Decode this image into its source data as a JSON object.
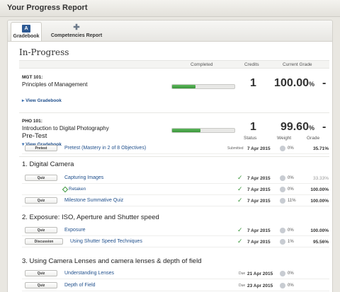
{
  "header": {
    "title": "Your Progress Report"
  },
  "tabs": [
    {
      "label": "Gradebook",
      "icon": "gradebook-icon",
      "active": true
    },
    {
      "label": "Competencies Report",
      "icon": "puzzle-icon",
      "active": false
    }
  ],
  "section_title": "In-Progress",
  "columns": {
    "completed": "Completed",
    "credits": "Credits",
    "current_grade": "Current Grade"
  },
  "courses": [
    {
      "code": "MGT 101:",
      "name": "Principles of Management",
      "progress": 0.37,
      "credits": "1",
      "grade": "100.00",
      "grade_suffix": "%",
      "dash": "-",
      "link": "View Gradebook",
      "expanded": false
    },
    {
      "code": "PHO 101:",
      "name": "Introduction to Digital Photography",
      "progress": 0.45,
      "credits": "1",
      "grade": "99.60",
      "grade_suffix": "%",
      "dash": "-",
      "link": "View Gradebook",
      "expanded": true
    }
  ],
  "item_columns": {
    "status": "Status",
    "weight": "Weight",
    "grade": "Grade"
  },
  "units": [
    {
      "title": "Pre-Test",
      "items": [
        {
          "type": "Pretest",
          "name": "Pretest (Mastery in 2 of 8 Objectives)",
          "status": "Submitted",
          "date": "7 Apr 2015",
          "weight": "0%",
          "grade": "35.71%"
        }
      ]
    },
    {
      "title": "1. Digital Camera",
      "items": [
        {
          "type": "Quiz",
          "name": "Capturing Images",
          "check": true,
          "date": "7 Apr 2015",
          "weight": "0%",
          "grade": "33.33%",
          "muted": true
        },
        {
          "type": "",
          "name": "Retaken",
          "check": true,
          "date": "7 Apr 2015",
          "weight": "0%",
          "grade": "100.00%",
          "retaken": true
        },
        {
          "type": "Quiz",
          "name": "Milestone Summative Quiz",
          "check": true,
          "date": "7 Apr 2015",
          "weight": "11%",
          "grade": "100.00%"
        }
      ]
    },
    {
      "title": "2. Exposure: ISO, Aperture and Shutter speed",
      "items": [
        {
          "type": "Quiz",
          "name": "Exposure",
          "check": true,
          "date": "7 Apr 2015",
          "weight": "0%",
          "grade": "100.00%"
        },
        {
          "type": "Discussion",
          "name": "Using Shutter Speed Techniques",
          "check": true,
          "date": "7 Apr 2015",
          "weight": "1%",
          "grade": "95.56%"
        }
      ]
    },
    {
      "title": "3. Using Camera Lenses and camera lenses & depth of field",
      "items": [
        {
          "type": "Quiz",
          "name": "Understanding Lenses",
          "status": "Due",
          "date": "21 Apr 2015",
          "weight": "0%",
          "grade": ""
        },
        {
          "type": "Quiz",
          "name": "Depth of Field",
          "status": "Due",
          "date": "23 Apr 2015",
          "weight": "0%",
          "grade": ""
        }
      ]
    }
  ],
  "colors": {
    "progress_fill": "#3a963a",
    "link": "#1f4f8c",
    "check": "#3a963a"
  }
}
